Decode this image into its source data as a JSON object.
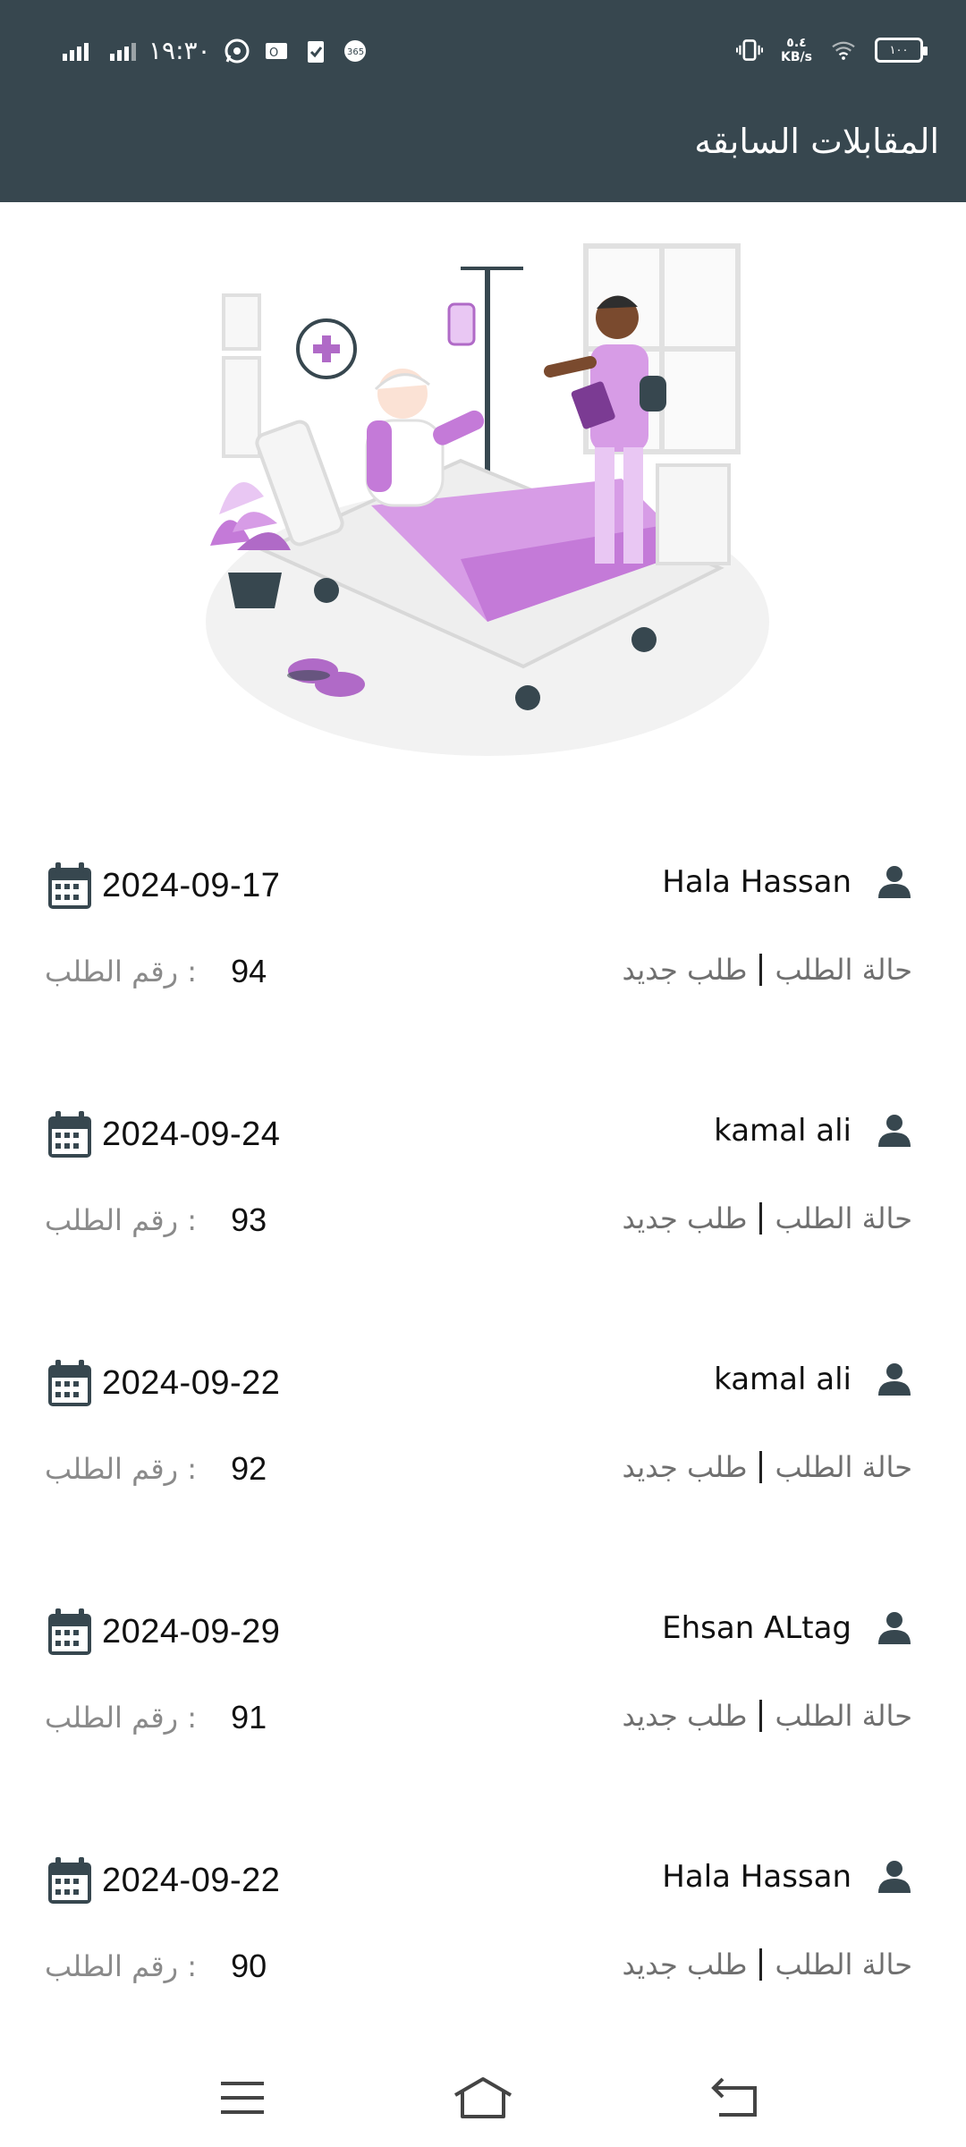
{
  "status_bar": {
    "time": "١٩:٣٠",
    "net_speed_value": "٥.٤",
    "net_speed_unit": "KB/s",
    "battery": "١٠٠",
    "icons": [
      "signal-icon",
      "signal-icon",
      "whatsapp-icon",
      "outlook-icon",
      "clipboard-check-icon",
      "office365-icon",
      "vibrate-icon",
      "wifi-icon",
      "battery-icon"
    ]
  },
  "app_bar": {
    "title": "المقابلات السابقه"
  },
  "hero": {
    "illustration": "hospital-bed-patient-doctor-illustration",
    "accent_color": "#b06ac7"
  },
  "list": {
    "status_label": "حالة الطلب",
    "request_number_label": ": رقم الطلب",
    "items": [
      {
        "name": "Hala Hassan",
        "date": "2024-09-17",
        "status": "طلب جديد",
        "request_number": "94"
      },
      {
        "name": "kamal ali",
        "date": "2024-09-24",
        "status": "طلب جديد",
        "request_number": "93"
      },
      {
        "name": "kamal ali",
        "date": "2024-09-22",
        "status": "طلب جديد",
        "request_number": "92"
      },
      {
        "name": "Ehsan ALtag",
        "date": "2024-09-29",
        "status": "طلب جديد",
        "request_number": "91"
      },
      {
        "name": "Hala Hassan",
        "date": "2024-09-22",
        "status": "طلب جديد",
        "request_number": "90"
      }
    ]
  },
  "nav_bar": {
    "buttons": [
      "menu-icon",
      "home-icon",
      "back-icon"
    ]
  },
  "colors": {
    "header": "#37474f",
    "icon": "#37474f",
    "muted_text": "#8a8a8a",
    "accent": "#b06ac7"
  }
}
